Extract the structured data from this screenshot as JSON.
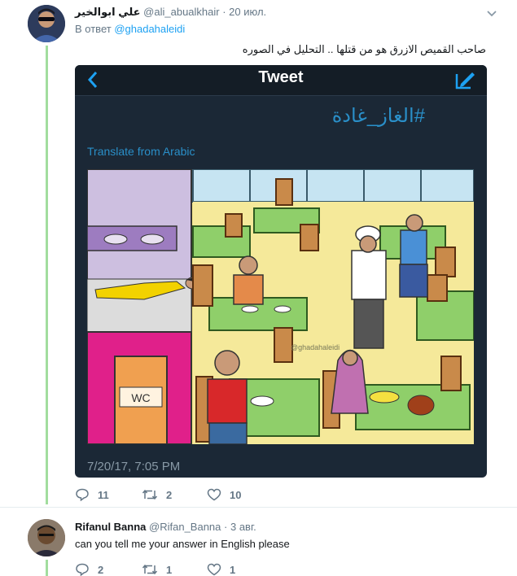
{
  "tweets": [
    {
      "author_name": "علي ابوالخير",
      "handle": "@ali_abualkhair",
      "date": "· 20 июл.",
      "reply_prefix": "В ответ",
      "reply_mention": "@ghadahaleidi",
      "text": "صاحب القميص الازرق هو من قتلها .. التحليل في الصوره",
      "media": {
        "bar_title": "Tweet",
        "hashtag": "#الغاز_غادة",
        "translate_label": "Translate from Arabic",
        "watermark": "@ghadahaleidi",
        "wc_sign": "WC",
        "date": "7/20/17, 7:05 PM"
      },
      "actions": {
        "replies": "11",
        "retweets": "2",
        "likes": "10"
      }
    },
    {
      "author_name": "Rifanul Banna",
      "handle": "@Rifan_Banna",
      "date": "· 3 авг.",
      "text": "can you tell me your answer in English please",
      "actions": {
        "replies": "2",
        "retweets": "1",
        "likes": "1"
      }
    }
  ],
  "icons": {
    "reply": "reply-icon",
    "retweet": "retweet-icon",
    "like": "heart-icon",
    "caret": "chevron-down-icon",
    "back": "back-arrow-icon",
    "compose": "compose-icon"
  },
  "colors": {
    "accent": "#1da1f2",
    "thread_line": "#a2dd9e",
    "media_bg": "#1b2836",
    "link_blue": "#2a8fc8"
  }
}
